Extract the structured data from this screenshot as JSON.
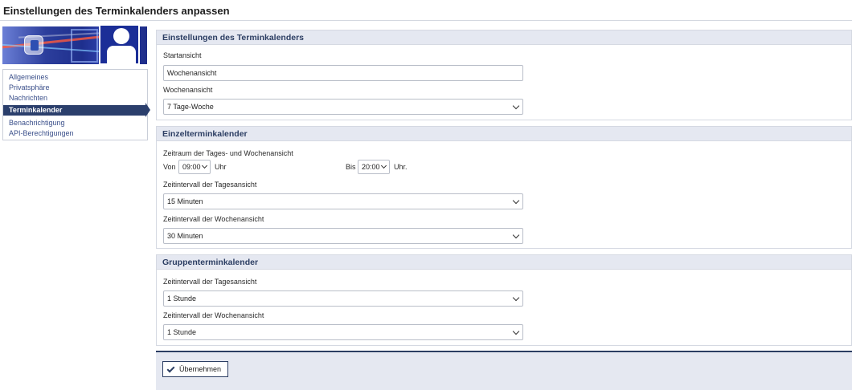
{
  "page": {
    "title": "Einstellungen des Terminkalenders anpassen"
  },
  "sidebar": {
    "items": [
      {
        "label": "Allgemeines",
        "active": false
      },
      {
        "label": "Privatsphäre",
        "active": false
      },
      {
        "label": "Nachrichten",
        "active": false
      },
      {
        "label": "Terminkalender",
        "active": true
      },
      {
        "label": "Benachrichtigung",
        "active": false
      },
      {
        "label": "API-Berechtigungen",
        "active": false
      }
    ]
  },
  "sections": {
    "general": {
      "title": "Einstellungen des Terminkalenders",
      "start_label": "Startansicht",
      "start_value": "Wochenansicht",
      "week_label": "Wochenansicht",
      "week_value": "7 Tage-Woche"
    },
    "single": {
      "title": "Einzelterminkalender",
      "range_label": "Zeitraum der Tages- und Wochenansicht",
      "from_label": "Von",
      "from_value": "09:00",
      "from_unit": "Uhr",
      "to_label": "Bis",
      "to_value": "20:00",
      "to_unit": "Uhr.",
      "day_interval_label": "Zeitintervall der Tagesansicht",
      "day_interval_value": "15 Minuten",
      "week_interval_label": "Zeitintervall der Wochenansicht",
      "week_interval_value": "30 Minuten"
    },
    "group": {
      "title": "Gruppenterminkalender",
      "day_interval_label": "Zeitintervall der Tagesansicht",
      "day_interval_value": "1 Stunde",
      "week_interval_label": "Zeitintervall der Wochenansicht",
      "week_interval_value": "1 Stunde"
    }
  },
  "footer": {
    "apply_label": "Übernehmen"
  },
  "colors": {
    "accent": "#2b3f6c",
    "section_header": "#e5e8f1",
    "link": "#3a4f8a"
  }
}
